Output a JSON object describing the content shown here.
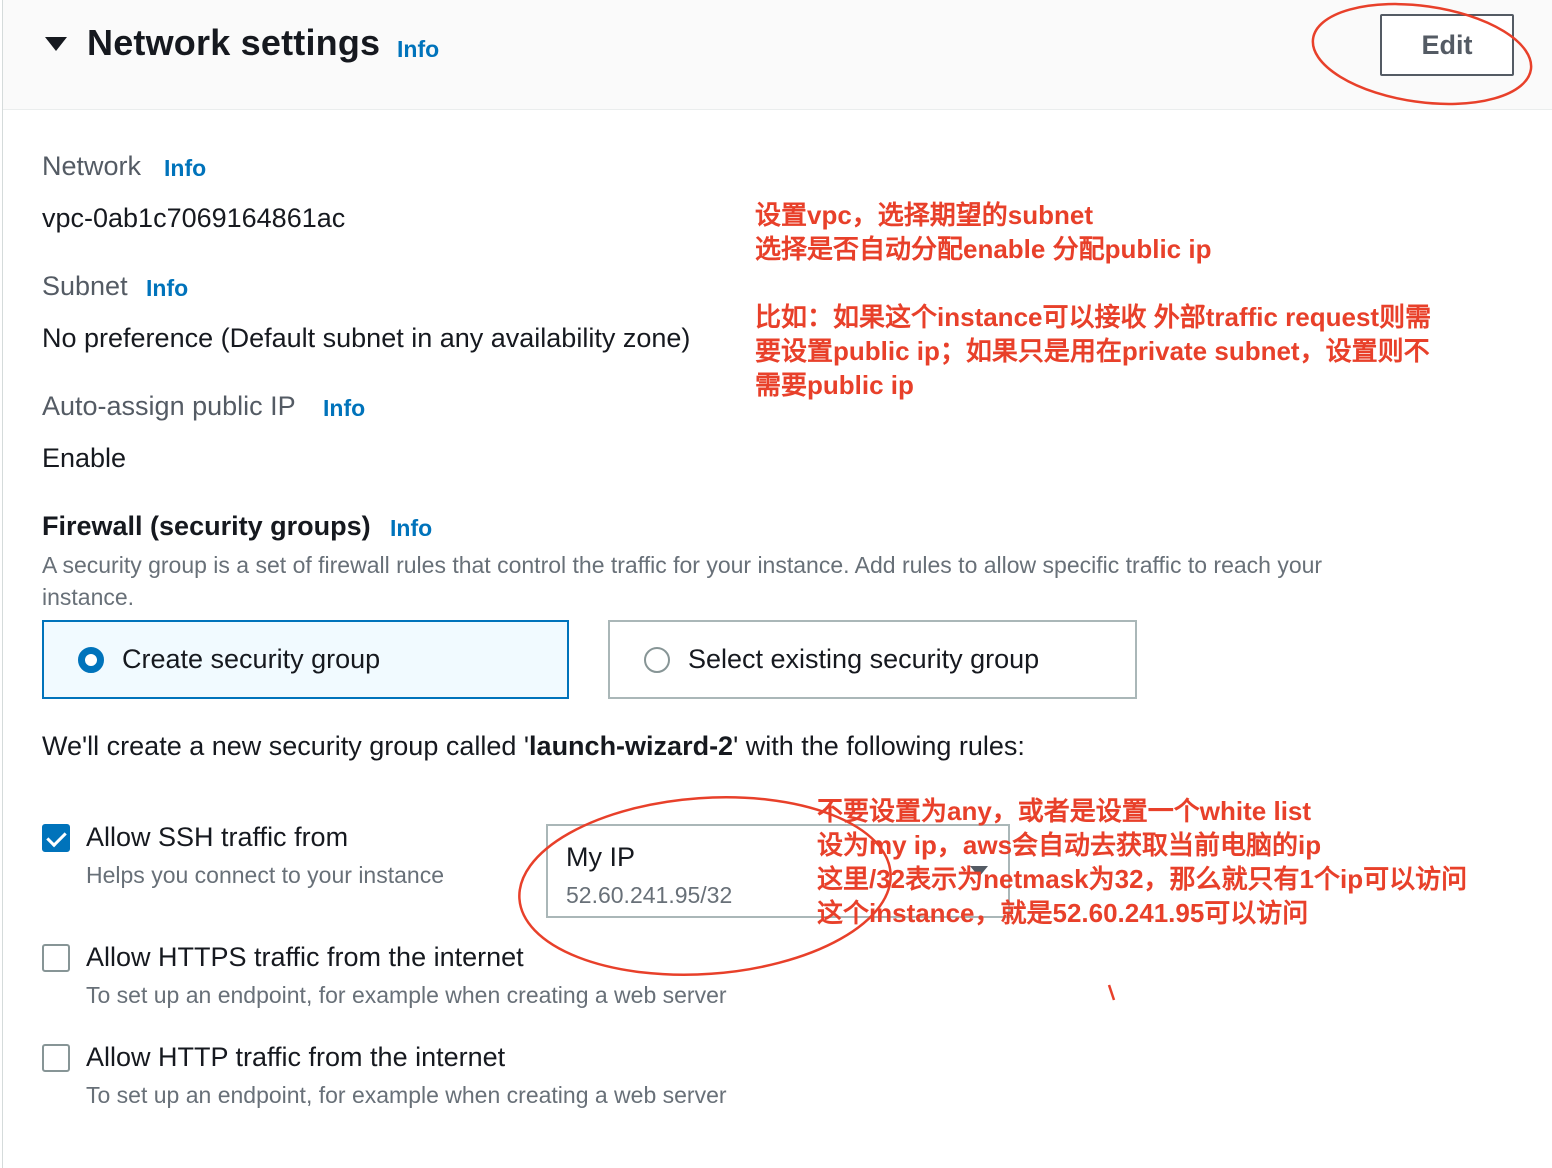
{
  "header": {
    "title": "Network settings",
    "info_label": "Info",
    "edit_label": "Edit"
  },
  "network": {
    "label": "Network",
    "info_label": "Info",
    "value": "vpc-0ab1c7069164861ac"
  },
  "subnet": {
    "label": "Subnet",
    "info_label": "Info",
    "value": "No preference (Default subnet in any availability zone)"
  },
  "auto_assign": {
    "label": "Auto-assign public IP",
    "info_label": "Info",
    "value": "Enable"
  },
  "firewall": {
    "title": "Firewall (security groups)",
    "info_label": "Info",
    "description_line1": "A security group is a set of firewall rules that control the traffic for your instance. Add rules to allow specific traffic to reach your",
    "description_line2": "instance.",
    "options": [
      {
        "label": "Create security group",
        "selected": true
      },
      {
        "label": "Select existing security group",
        "selected": false
      }
    ],
    "create_text_prefix": "We'll create a new security group called '",
    "group_name": "launch-wizard-2",
    "create_text_suffix": "' with the following rules:"
  },
  "rules": [
    {
      "label": "Allow SSH traffic from",
      "description": "Helps you connect to your instance",
      "checked": true
    },
    {
      "label": "Allow HTTPS traffic from the internet",
      "description": "To set up an endpoint, for example when creating a web server",
      "checked": false
    },
    {
      "label": "Allow HTTP traffic from the internet",
      "description": "To set up an endpoint, for example when creating a web server",
      "checked": false
    }
  ],
  "ssh_source": {
    "selected": "My IP",
    "cidr": "52.60.241.95/32"
  },
  "annotations": {
    "color": "#e8402a",
    "note1_line1": "设置vpc，选择期望的subnet",
    "note1_line2": "选择是否自动分配enable 分配public ip",
    "note2_line1": "比如：如果这个instance可以接收 外部traffic request则需",
    "note2_line2": "要设置public ip；如果只是用在private subnet，设置则不",
    "note2_line3": "需要public ip",
    "note3_line1": "不要设置为any，或者是设置一个white list",
    "note3_line2": "设为my ip，aws会自动去获取当前电脑的ip",
    "note3_line3": "这里/32表示为netmask为32，那么就只有1个ip可以访问",
    "note3_line4": "这个instance，就是52.60.241.95可以访问"
  },
  "colors": {
    "accent": "#0073bb",
    "annotation": "#e8402a"
  }
}
